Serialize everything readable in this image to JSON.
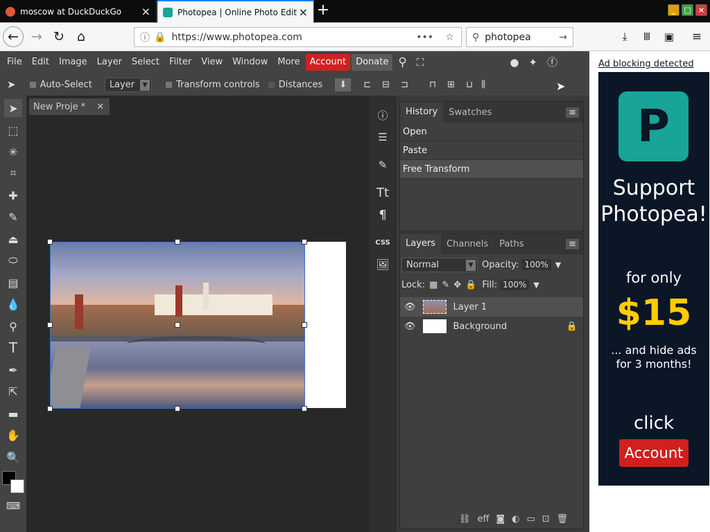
{
  "tabs": [
    {
      "title": "moscow at DuckDuckGo",
      "active": false
    },
    {
      "title": "Photopea | Online Photo Edit",
      "active": true
    }
  ],
  "new_tab_label": "+",
  "browser": {
    "url": "https://www.photopea.com",
    "search_value": "photopea",
    "page_actions": "•••"
  },
  "menu": {
    "items": [
      "File",
      "Edit",
      "Image",
      "Layer",
      "Select",
      "Filter",
      "View",
      "Window",
      "More"
    ],
    "account": "Account",
    "donate": "Donate"
  },
  "ad_notice": "Ad blocking detected",
  "options": {
    "auto_select": "Auto-Select",
    "layer_select": "Layer",
    "transform_controls": "Transform controls",
    "distances": "Distances"
  },
  "document": {
    "tab": "New Proje",
    "modified": "*",
    "close": "✕"
  },
  "history": {
    "tabs": [
      "History",
      "Swatches"
    ],
    "items": [
      "Open",
      "Paste",
      "Free Transform"
    ]
  },
  "layers": {
    "tabs": [
      "Layers",
      "Channels",
      "Paths"
    ],
    "blend_mode": "Normal",
    "opacity_label": "Opacity:",
    "opacity_value": "100%",
    "lock_label": "Lock:",
    "fill_label": "Fill:",
    "fill_value": "100%",
    "items": [
      {
        "name": "Layer 1"
      },
      {
        "name": "Background"
      }
    ]
  },
  "ad": {
    "line1": "Support",
    "line2": "Photopea!",
    "for_only": "for only",
    "price": "$15",
    "hide1": "... and hide ads",
    "hide2": "for 3 months!",
    "click": "click",
    "button": "Account"
  },
  "colors": {
    "accent": "#d02020",
    "ad_bg": "#0b1627",
    "price": "#ffcc00",
    "logo": "#18a497"
  }
}
